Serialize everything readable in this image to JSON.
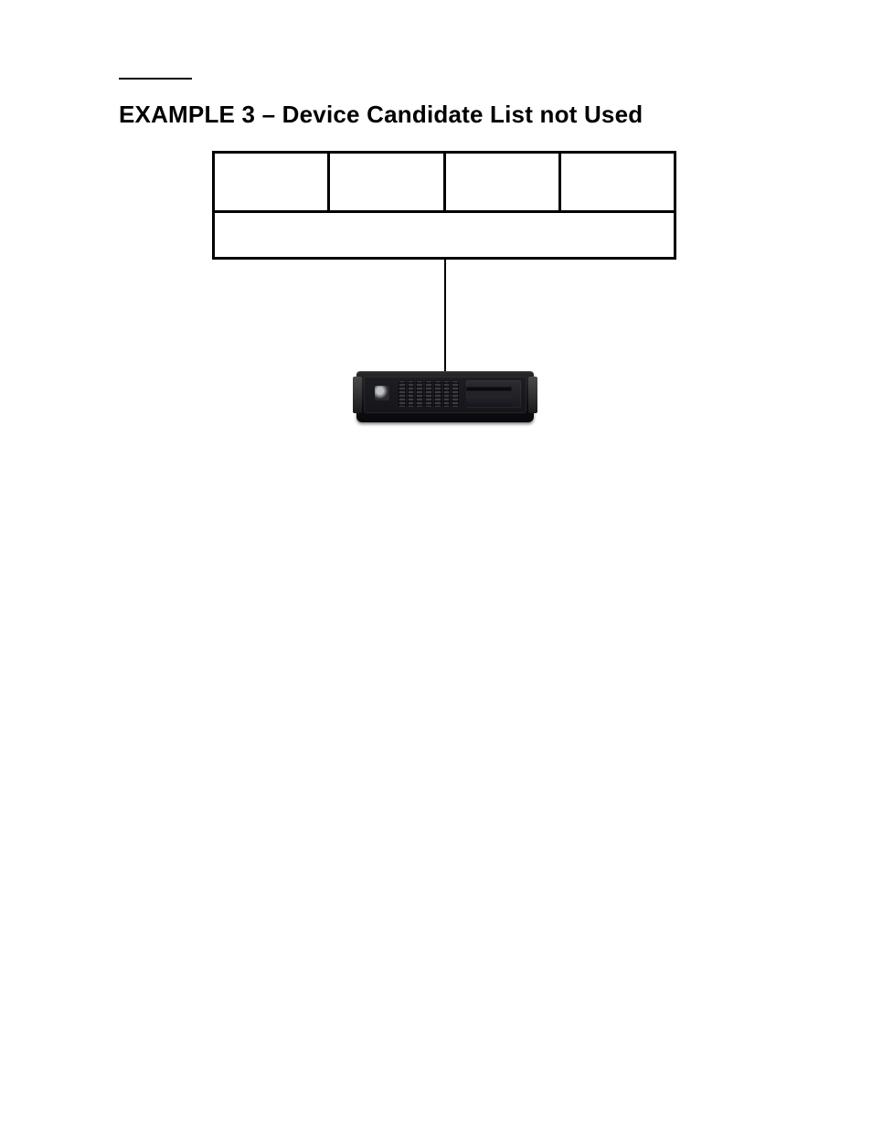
{
  "title": "EXAMPLE 3 – Device Candidate List not Used",
  "table": {
    "row1_cells": [
      "",
      "",
      "",
      ""
    ],
    "row2": ""
  }
}
